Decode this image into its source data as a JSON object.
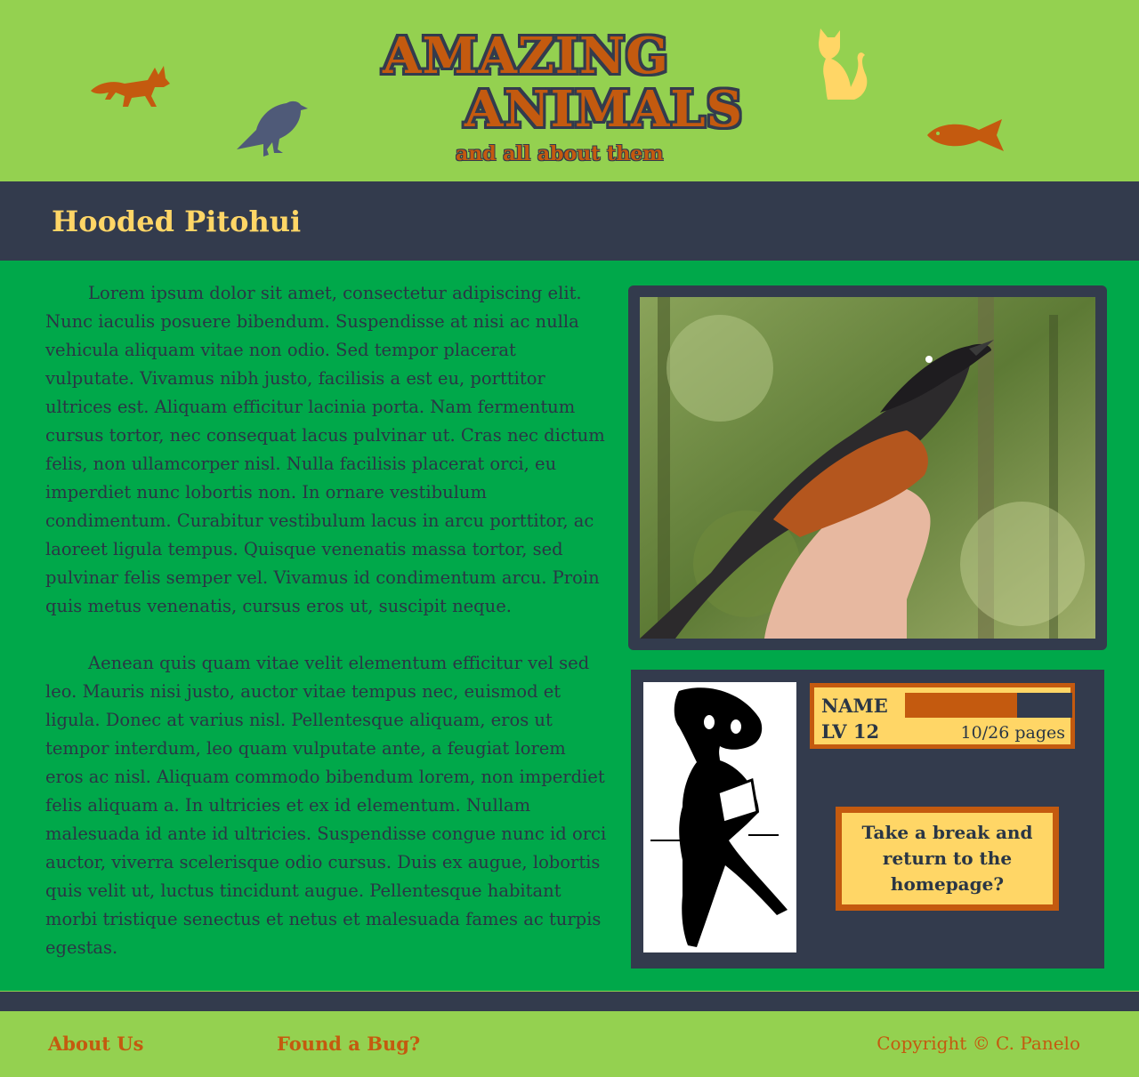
{
  "header": {
    "brand_line1": "AMAZING",
    "brand_line2": "ANIMALS",
    "tagline": "and all about them",
    "icons": [
      "fox-icon",
      "bird-icon",
      "cat-icon",
      "fish-icon"
    ]
  },
  "page": {
    "title": "Hooded Pitohui"
  },
  "article": {
    "paragraphs": [
      "Lorem ipsum dolor sit amet, consectetur adipiscing elit. Nunc iaculis posuere bibendum. Suspendisse at nisi ac nulla vehicula aliquam vitae non odio. Sed tempor placerat vulputate. Vivamus nibh justo, facilisis a est eu, porttitor ultrices est. Aliquam efficitur lacinia porta. Nam fermentum cursus tortor, nec consequat lacus pulvinar ut. Cras nec dictum felis, non ullamcorper nisl. Nulla facilisis placerat orci, eu imperdiet nunc lobortis non. In ornare vestibulum condimentum. Curabitur vestibulum lacus in arcu porttitor, ac laoreet ligula tempus. Quisque venenatis massa tortor, sed pulvinar felis semper vel. Vivamus id condimentum arcu. Proin quis metus venenatis, cursus eros ut, suscipit neque.",
      "Aenean quis quam vitae velit elementum efficitur vel sed leo. Mauris nisi justo, auctor vitae tempus nec, euismod et ligula. Donec at varius nisl. Pellentesque aliquam, eros ut tempor interdum, leo quam vulputate ante, a feugiat lorem eros ac nisl. Aliquam commodo bibendum lorem, non imperdiet felis aliquam a. In ultricies et ex id elementum. Nullam malesuada id ante id ultricies. Suspendisse congue nunc id orci auctor, viverra scelerisque odio cursus. Duis ex augue, lobortis quis velit ut, luctus tincidunt augue. Pellentesque habitant morbi tristique senectus et netus et malesuada fames ac turpis egestas."
    ]
  },
  "reader": {
    "name_label": "NAME",
    "level_label": "LV 12",
    "progress_text": "10/26 pages",
    "progress_fraction": 0.67,
    "break_button": "Take a break and return to the homepage?"
  },
  "footer": {
    "about": "About Us",
    "bug": "Found a Bug?",
    "copyright": "Copyright © C. Panelo"
  },
  "colors": {
    "header_bg": "#94d150",
    "content_bg": "#00a84a",
    "dark": "#333b4d",
    "accent_orange": "#c45a0f",
    "accent_yellow": "#ffd666"
  }
}
